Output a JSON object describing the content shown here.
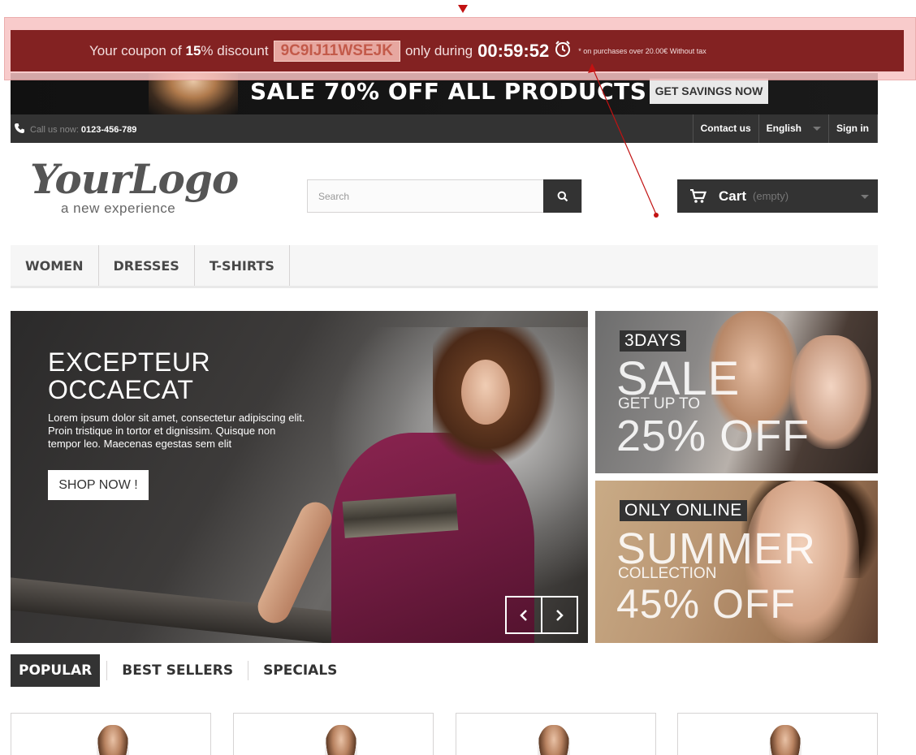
{
  "coupon": {
    "prefix": "Your coupon of",
    "percent": "15",
    "suffix": "% discount",
    "code": "9C9IJ11WSEJK",
    "during": "only during",
    "timer": "00:59:52",
    "note": "* on purchases over 20.00€ Without tax"
  },
  "promo": {
    "title": "SALE 70% OFF ALL PRODUCTS",
    "cta": "GET SAVINGS NOW"
  },
  "top_nav": {
    "call_label": "Call us now:",
    "phone": "0123-456-789",
    "links": [
      "Contact us",
      "English",
      "Sign in"
    ]
  },
  "logo": {
    "script": "YourLogo",
    "tagline": "a new experience"
  },
  "search": {
    "placeholder": "Search"
  },
  "cart": {
    "label": "Cart",
    "status": "(empty)"
  },
  "menu": {
    "items": [
      "WOMEN",
      "DRESSES",
      "T-SHIRTS"
    ]
  },
  "slider": {
    "title_line1": "EXCEPTEUR",
    "title_line2": "OCCAECAT",
    "text": "Lorem ipsum dolor sit amet, consectetur adipiscing elit. Proin tristique in tortor et dignissim. Quisque non tempor leo. Maecenas egestas sem elit",
    "button": "SHOP NOW !"
  },
  "banners": [
    {
      "tag": "3DAYS",
      "big1": "SALE",
      "small": "GET UP TO",
      "big2": "25% OFF"
    },
    {
      "tag": "ONLY ONLINE",
      "big1": "SUMMER",
      "small": "COLLECTION",
      "big2": "45% OFF"
    }
  ],
  "tabs": [
    "POPULAR",
    "BEST SELLERS",
    "SPECIALS"
  ],
  "colors": {
    "dark": "#333333",
    "coupon_bg": "#781414",
    "coupon_code_bg": "#e7a7a0",
    "marker": "#c21212"
  }
}
